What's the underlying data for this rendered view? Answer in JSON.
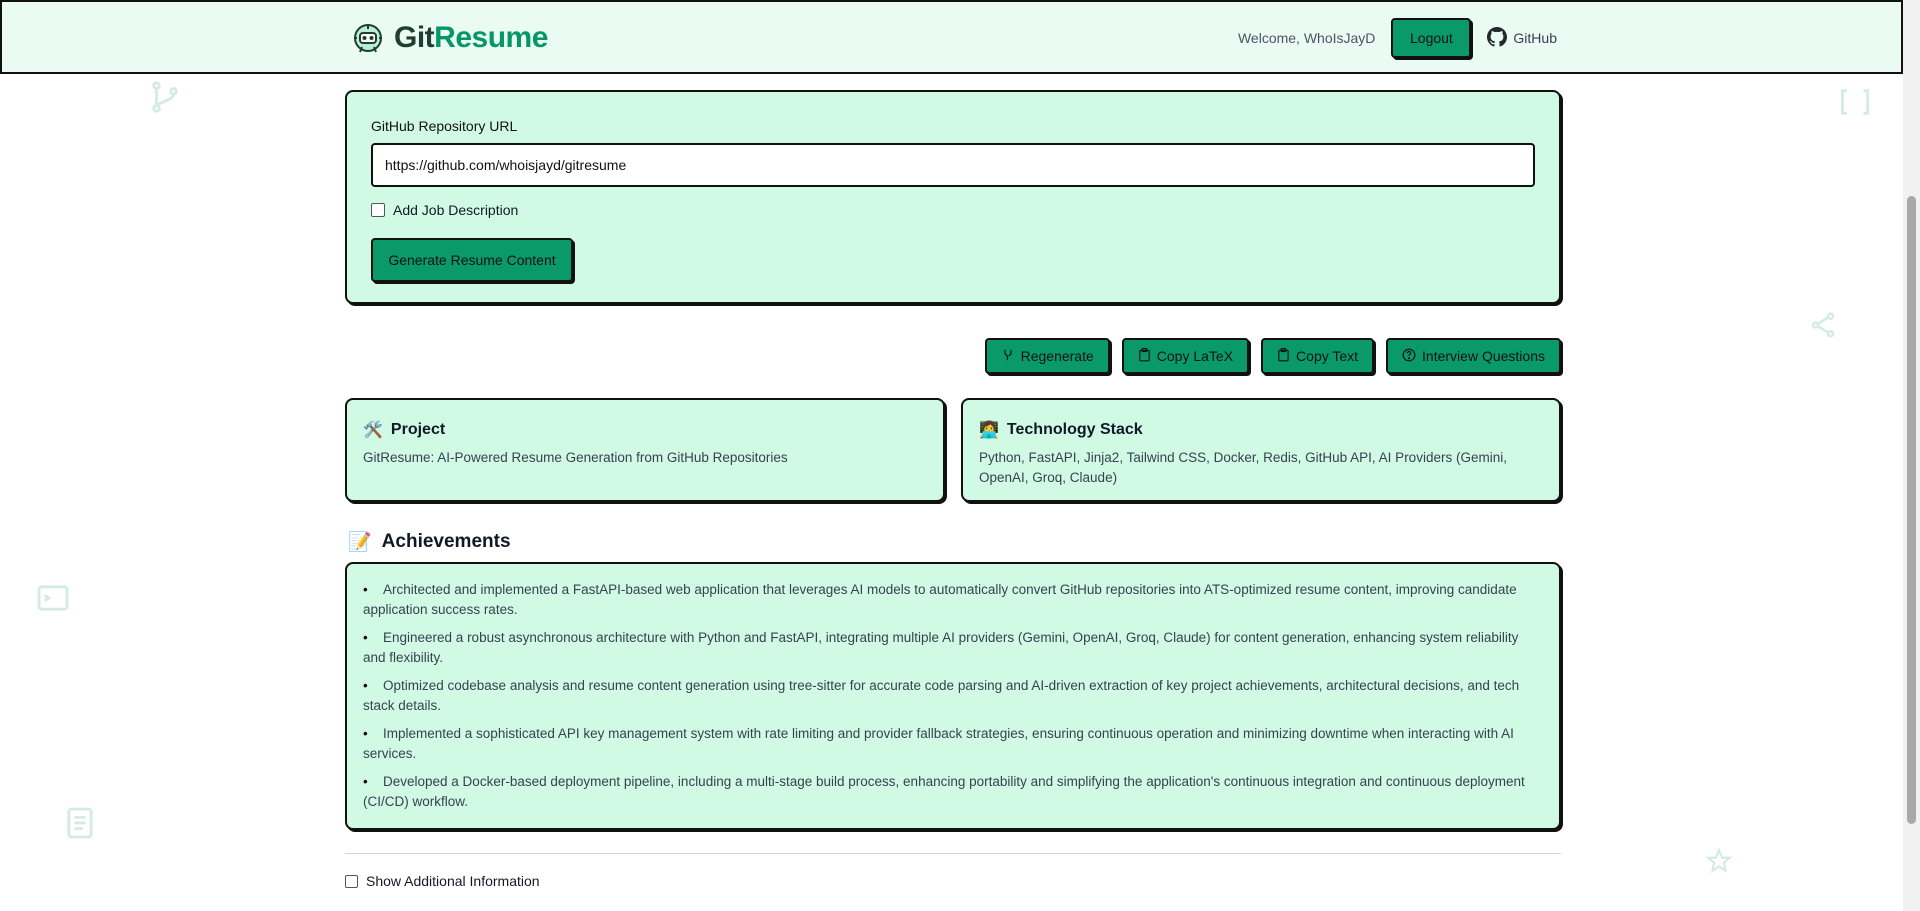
{
  "header": {
    "brand_git": "Git",
    "brand_resume": "Resume",
    "welcome": "Welcome, WhoIsJayD",
    "logout_label": "Logout",
    "github_label": "GitHub"
  },
  "form": {
    "url_label": "GitHub Repository URL",
    "url_value": "https://github.com/whoisjayd/gitresume",
    "job_description_label": "Add Job Description",
    "job_description_checked": false,
    "generate_label": "Generate Resume Content"
  },
  "actions": {
    "regenerate": "Regenerate",
    "copy_latex": "Copy LaTeX",
    "copy_text": "Copy Text",
    "interview_questions": "Interview Questions"
  },
  "project": {
    "icon": "🛠️",
    "title": "Project",
    "value": "GitResume: AI-Powered Resume Generation from GitHub Repositories"
  },
  "tech": {
    "icon": "👩‍💻",
    "title": "Technology Stack",
    "value": "Python, FastAPI, Jinja2, Tailwind CSS, Docker, Redis, GitHub API, AI Providers (Gemini, OpenAI, Groq, Claude)"
  },
  "achievements": {
    "icon": "📝",
    "title": "Achievements",
    "bullet": "•",
    "items": [
      "Architected and implemented a FastAPI-based web application that leverages AI models to automatically convert GitHub repositories into ATS-optimized resume content, improving candidate application success rates.",
      "Engineered a robust asynchronous architecture with Python and FastAPI, integrating multiple AI providers (Gemini, OpenAI, Groq, Claude) for content generation, enhancing system reliability and flexibility.",
      "Optimized codebase analysis and resume content generation using tree-sitter for accurate code parsing and AI-driven extraction of key project achievements, architectural decisions, and tech stack details.",
      "Implemented a sophisticated API key management system with rate limiting and provider fallback strategies, ensuring continuous operation and minimizing downtime when interacting with AI services.",
      "Developed a Docker-based deployment pipeline, including a multi-stage build process, enhancing portability and simplifying the application's continuous integration and continuous deployment (CI/CD) workflow."
    ]
  },
  "additional": {
    "label": "Show Additional Information",
    "checked": false
  },
  "colors": {
    "accent": "#0a9a6a",
    "card_bg": "#d1fae5",
    "header_bg": "#e9fbf2",
    "brand_green": "#069668"
  }
}
